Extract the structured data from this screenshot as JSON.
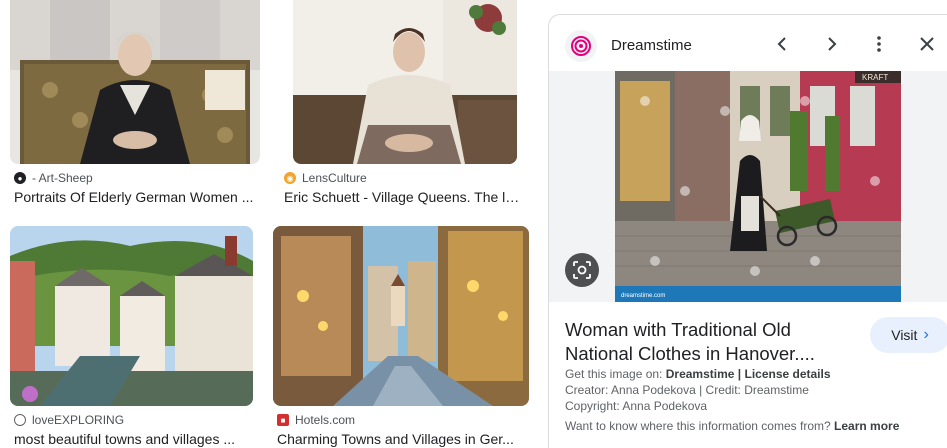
{
  "results": [
    {
      "source": "- Art-Sheep",
      "title": "Portraits Of Elderly German Women ...",
      "favicon": "art-sheep-favicon"
    },
    {
      "source": "LensCulture",
      "title": "Eric Schuett - Village Queens. The la...",
      "favicon": "lensculture-favicon"
    },
    {
      "source": "loveEXPLORING",
      "title": "most beautiful towns and villages ...",
      "favicon": "globe-icon"
    },
    {
      "source": "Hotels.com",
      "title": "Charming Towns and Villages in Ger...",
      "favicon": "hotels-favicon"
    }
  ],
  "panel": {
    "site_name": "Dreamstime",
    "title": "Woman with Traditional Old National Clothes in Hanover....",
    "visit_label": "Visit",
    "get_image_prefix": "Get this image on:",
    "get_image_site": "Dreamstime",
    "separator": "|",
    "license_details": "License details",
    "creator_line": "Creator: Anna Podekova | Credit: Dreamstime",
    "copyright_line": "Copyright: Anna Podekova",
    "know_where": "Want to know where this information comes from?",
    "learn_more": "Learn more",
    "image_caption_left": "dreamstime.com",
    "sign_text": "KRAFT"
  },
  "colors": {
    "accent": "#1a73e8",
    "visit_bg": "#e8f0fe",
    "dreamstime": "#e4007c"
  }
}
